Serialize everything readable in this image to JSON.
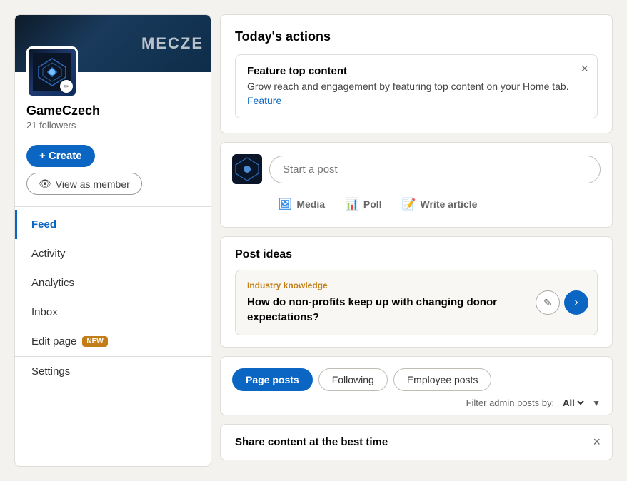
{
  "sidebar": {
    "company_name": "GameCzech",
    "followers_text": "21 followers",
    "create_button": "+ Create",
    "view_member_button": "View as member",
    "nav_items": [
      {
        "id": "feed",
        "label": "Feed",
        "active": true,
        "badge": null
      },
      {
        "id": "activity",
        "label": "Activity",
        "active": false,
        "badge": null
      },
      {
        "id": "analytics",
        "label": "Analytics",
        "active": false,
        "badge": null
      },
      {
        "id": "inbox",
        "label": "Inbox",
        "active": false,
        "badge": null
      },
      {
        "id": "edit-page",
        "label": "Edit page",
        "active": false,
        "badge": "NEW"
      },
      {
        "id": "settings",
        "label": "Settings",
        "active": false,
        "badge": null
      }
    ]
  },
  "todays_actions": {
    "title": "Today's actions",
    "feature_card": {
      "title": "Feature top content",
      "description": "Grow reach and engagement by featuring top content on your Home tab.",
      "link_text": "Feature"
    }
  },
  "post_area": {
    "placeholder": "Start a post",
    "media_label": "Media",
    "poll_label": "Poll",
    "article_label": "Write article"
  },
  "post_ideas": {
    "title": "Post ideas",
    "idea_category": "Industry knowledge",
    "idea_text": "How do non-profits keep up with changing donor expectations?"
  },
  "tabs": {
    "items": [
      {
        "id": "page-posts",
        "label": "Page posts",
        "active": true
      },
      {
        "id": "following",
        "label": "Following",
        "active": false
      },
      {
        "id": "employee-posts",
        "label": "Employee posts",
        "active": false
      }
    ],
    "filter_label": "Filter admin posts by:",
    "filter_value": "All"
  },
  "share_card": {
    "title": "Share content at the best time"
  }
}
